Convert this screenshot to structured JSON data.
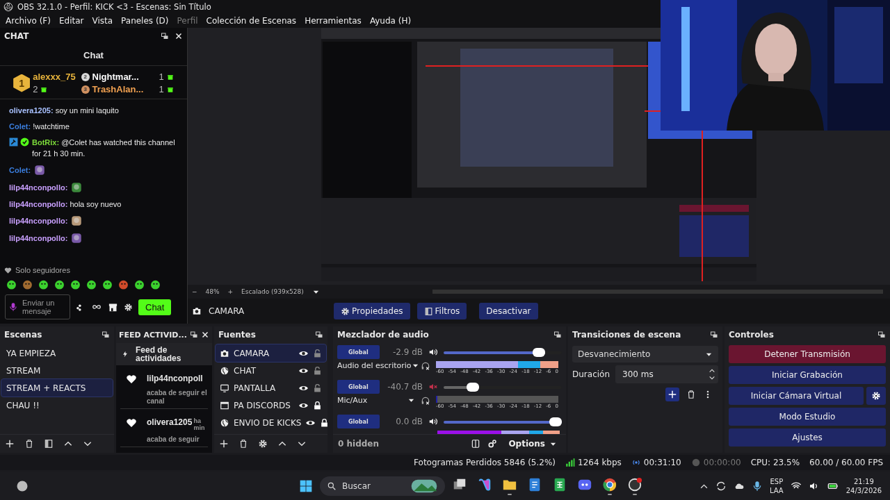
{
  "window": {
    "title": "OBS 32.1.0 - Perfil: KICK <3 - Escenas: Sin Título"
  },
  "menu": [
    {
      "label": "Archivo (F)",
      "disabled": false
    },
    {
      "label": "Editar",
      "disabled": false
    },
    {
      "label": "Vista",
      "disabled": false
    },
    {
      "label": "Paneles (D)",
      "disabled": false
    },
    {
      "label": "Perfil",
      "disabled": true
    },
    {
      "label": "Colección de Escenas",
      "disabled": false
    },
    {
      "label": "Herramientas",
      "disabled": false
    },
    {
      "label": "Ayuda (H)",
      "disabled": false
    }
  ],
  "chat_dock": {
    "title": "CHAT",
    "heading": "Chat",
    "leaders": [
      {
        "rank": "1",
        "name": "alexxx_75",
        "count": "2",
        "color": "#e8b43c"
      },
      {
        "rank": "2",
        "name": "Nightmar...",
        "count": "1",
        "color": "#ffffff"
      },
      {
        "rank": "3",
        "name": "TrashAlan...",
        "count": "1",
        "color": "#f0a050"
      }
    ],
    "messages": [
      {
        "kind": "text",
        "user": "olivera1205:",
        "color": "#a9c1ff",
        "text": "soy un mini laquito",
        "badges": false
      },
      {
        "kind": "text",
        "user": "Colet:",
        "color": "#3b7fe0",
        "text": "!watchtime",
        "badges": false
      },
      {
        "kind": "text",
        "user": "BotRix:",
        "color": "#7ddc3a",
        "text": "@Colet has watched this channel for 21 h 30 min.",
        "badges": true
      },
      {
        "kind": "emote",
        "user": "Colet:",
        "color": "#3b7fe0",
        "badges": false
      },
      {
        "kind": "emote",
        "user": "lilp44nconpollo:",
        "color": "#c9a0ff",
        "badges": false
      },
      {
        "kind": "text",
        "user": "lilp44nconpollo:",
        "color": "#c9a0ff",
        "text": "hola soy nuevo",
        "badges": false
      },
      {
        "kind": "emote",
        "user": "lilp44nconpollo:",
        "color": "#c9a0ff",
        "badges": false
      },
      {
        "kind": "emote",
        "user": "lilp44nconpollo:",
        "color": "#c9a0ff",
        "badges": false
      }
    ],
    "mode": "Solo seguidores",
    "input": {
      "placeholder_before": "Enviar un",
      "placeholder_after": "mensaje"
    },
    "send_button": "Chat"
  },
  "preview": {
    "kind": "picture",
    "zoom": "48%",
    "minus": "−",
    "plus": "+",
    "scaling": "Escalado (939x528)"
  },
  "context_bar": {
    "source": "CAMARA",
    "buttons": [
      "Propiedades",
      "Filtros",
      "Desactivar"
    ]
  },
  "scenes": {
    "title": "Escenas",
    "items": [
      {
        "label": "YA EMPIEZA",
        "selected": false
      },
      {
        "label": "STREAM",
        "selected": false
      },
      {
        "label": "STREAM + REACTS",
        "selected": true
      },
      {
        "label": "CHAU !!",
        "selected": false
      }
    ]
  },
  "feed": {
    "title": "FEED ACTIVID...",
    "heading": "Feed de actividades",
    "items": [
      {
        "user": "lilp44nconpoll",
        "action": "acaba de seguir el canal"
      },
      {
        "user": "olivera1205",
        "time": [
          "ha",
          "min"
        ],
        "action": "acaba de seguir"
      }
    ]
  },
  "sources": {
    "title": "Fuentes",
    "items": [
      {
        "kind": "camera",
        "label": "CAMARA",
        "selected": true,
        "visible": true,
        "locked": false
      },
      {
        "kind": "browser",
        "label": "CHAT",
        "selected": false,
        "visible": true,
        "locked": false
      },
      {
        "kind": "display",
        "label": "PANTALLA",
        "selected": false,
        "visible": true,
        "locked": false
      },
      {
        "kind": "window",
        "label": "PA DISCORDS",
        "selected": false,
        "visible": true,
        "locked": true
      },
      {
        "kind": "browser",
        "label": "ENVIO DE KICKS",
        "selected": false,
        "visible": true,
        "locked": true
      }
    ]
  },
  "mixer": {
    "title": "Mezclador de audio",
    "hidden": "0 hidden",
    "options": "Options",
    "channels": [
      {
        "button": "Global",
        "db": "-2.9 dB",
        "muted": false,
        "level": 0.86,
        "name": "Audio del escritorio",
        "scale": [
          "-60",
          "-54",
          "-48",
          "-42",
          "-36",
          "-30",
          "-24",
          "-18",
          "-12",
          "-6",
          "0"
        ]
      },
      {
        "button": "Global",
        "db": "-40.7 dB",
        "muted": true,
        "level": 0.3,
        "name": "Mic/Aux",
        "scale": [
          "-60",
          "-54",
          "-48",
          "-42",
          "-36",
          "-30",
          "-24",
          "-18",
          "-12",
          "-6",
          "0"
        ]
      },
      {
        "button": "Global",
        "db": "0.0 dB",
        "muted": false,
        "level": 1.0
      }
    ]
  },
  "transitions": {
    "title": "Transiciones de escena",
    "type": "Desvanecimiento",
    "duration_label": "Duración",
    "duration": "300 ms"
  },
  "controls": {
    "title": "Controles",
    "buttons": [
      {
        "label": "Detener Transmisión",
        "active": true,
        "settings": false
      },
      {
        "label": "Iniciar Grabación",
        "active": false,
        "settings": false
      },
      {
        "label": "Iniciar Cámara Virtual",
        "active": false,
        "settings": true
      },
      {
        "label": "Modo Estudio",
        "active": false,
        "settings": false
      },
      {
        "label": "Ajustes",
        "active": false,
        "settings": false
      }
    ]
  },
  "status_bar": {
    "dropped": "Fotogramas Perdidos 5846 (5.2%)",
    "bitrate": "1264 kbps",
    "stream_time": "00:31:10",
    "record_time": "00:00:00",
    "cpu": "CPU: 23.5%",
    "fps": "60.00 / 60.00 FPS"
  },
  "taskbar": {
    "search": "Buscar",
    "lang": "ESP",
    "layout": "LAA",
    "time": "21:19",
    "date": "24/3/2026"
  }
}
